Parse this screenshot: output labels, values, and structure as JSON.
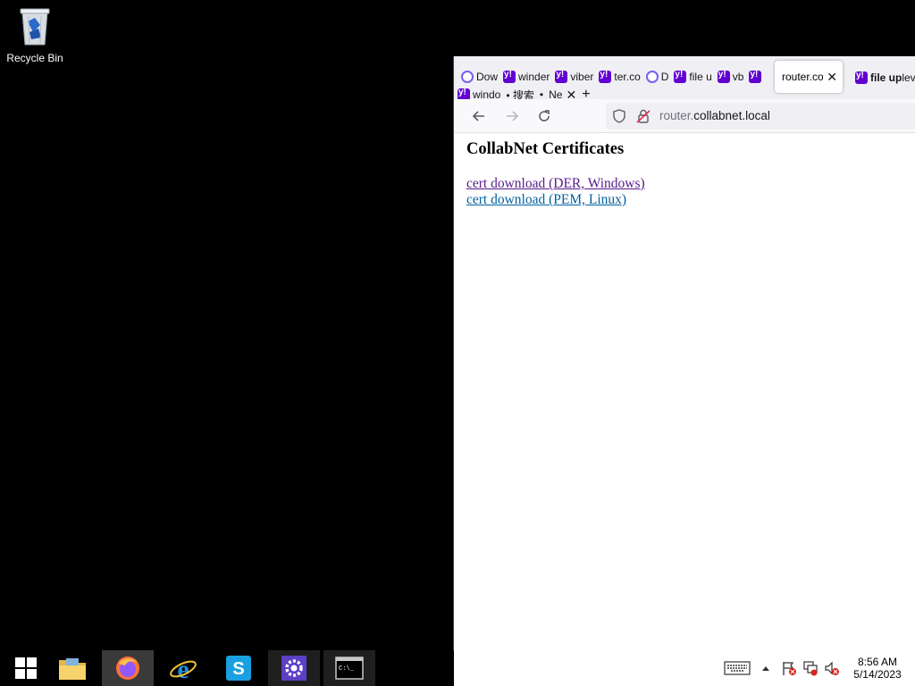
{
  "desktop": {
    "recycle_bin_label": "Recycle Bin"
  },
  "browser": {
    "tabs_row1": [
      {
        "icon": "viber-icon",
        "label": "Dow"
      },
      {
        "icon": "yahoo-icon",
        "label": "winder"
      },
      {
        "icon": "yahoo-icon",
        "label": "viber"
      },
      {
        "icon": "yahoo-icon",
        "label": "ter.co"
      },
      {
        "icon": "viber-icon",
        "label": "D"
      },
      {
        "icon": "yahoo-icon",
        "label": "file u"
      },
      {
        "icon": "yahoo-icon",
        "label": "vb"
      },
      {
        "icon": "yahoo-icon",
        "label": ""
      }
    ],
    "tabs_row2": [
      {
        "icon": "yahoo-icon",
        "label": "windo"
      },
      {
        "icon": "none",
        "label": "• 搜索"
      },
      {
        "icon": "none",
        "label": "•"
      },
      {
        "icon": "none",
        "label": "Ne"
      }
    ],
    "active_tab_label": "router.co",
    "right_tab_label": "file up",
    "right_tab_suffix": "lev",
    "url_domain": "router.",
    "url_rest": "collabnet.local"
  },
  "page": {
    "heading": "CollabNet Certificates",
    "links": [
      "cert download (DER, Windows)",
      "cert download (PEM, Linux)"
    ]
  },
  "taskbar": {
    "clock_time": "8:56 AM",
    "clock_date": "5/14/2023"
  },
  "colors": {
    "visited_link": "#551a8b",
    "link": "#0060a0",
    "yahoo_purple": "#6001d2",
    "viber_purple": "#7360f2"
  }
}
